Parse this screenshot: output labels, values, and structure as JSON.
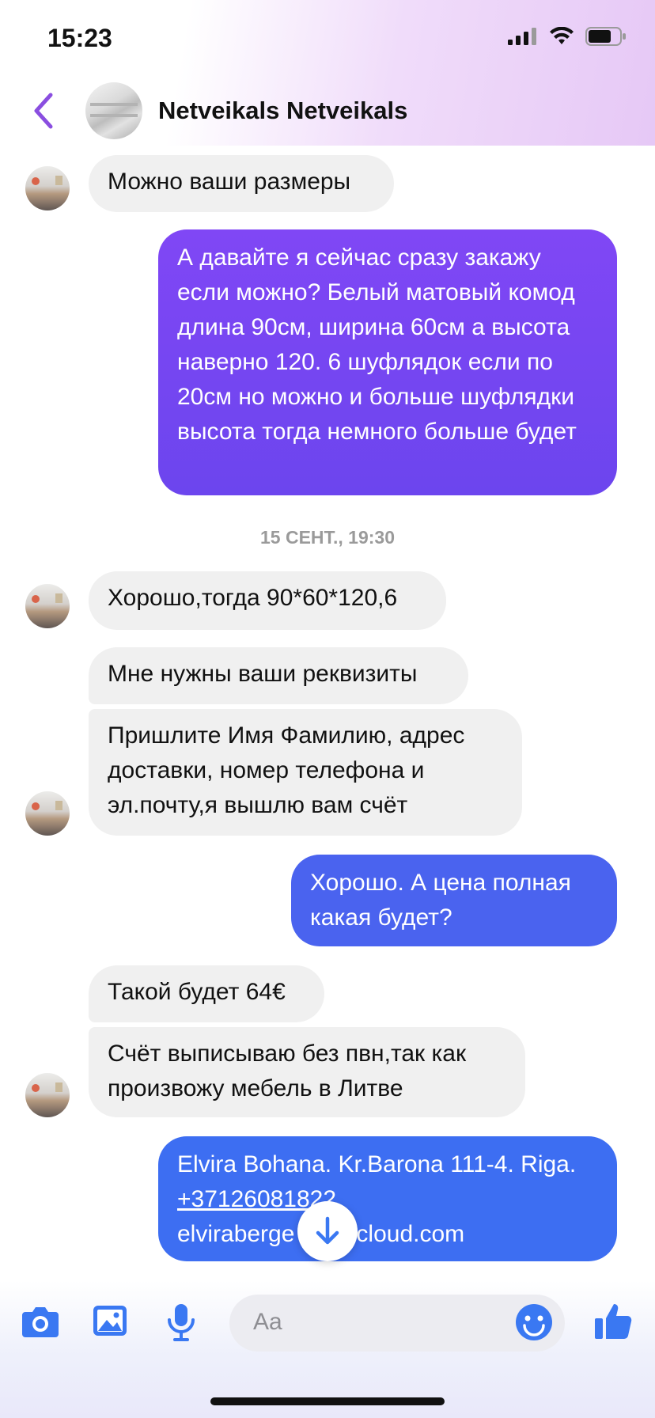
{
  "status_bar": {
    "time": "15:23",
    "icons": [
      "signal-icon",
      "wifi-icon",
      "battery-icon"
    ]
  },
  "header": {
    "back_icon": "chevron-left-icon",
    "contact_name": "Netveikals Netveikals",
    "accent_color": "#8a4ee0"
  },
  "colors": {
    "incoming_bg": "#f0f0f0",
    "outgoing_purple": "#7443f0",
    "outgoing_blue": "#3d6ef2"
  },
  "messages": [
    {
      "side": "in",
      "text": "Можно ваши размеры"
    },
    {
      "side": "out",
      "text": "А давайте я сейчас сразу закажу если можно? Белый матовый комод длина 90см, ширина 60см а высота наверно 120. 6 шуфлядок если по 20см но можно и больше шуфлядки высота тогда немного больше будет"
    },
    {
      "side": "separator",
      "text": "15 СЕНТ., 19:30"
    },
    {
      "side": "in",
      "text": "Хорошо,тогда 90*60*120,6"
    },
    {
      "side": "in",
      "text": "Мне нужны ваши реквизиты"
    },
    {
      "side": "in",
      "text": "Пришлите Имя Фамилию, адрес доставки, номер телефона и эл.почту,я вышлю вам счёт"
    },
    {
      "side": "out",
      "text": "Хорошо. А цена полная какая будет?"
    },
    {
      "side": "in",
      "text": "Такой будет 64€"
    },
    {
      "side": "in",
      "text": "Счёт выписываю без пвн,так как произвожу мебель в Литве"
    },
    {
      "side": "out",
      "line1": "Elvira Bohana. Kr.Barona 111-4. Riga.",
      "phone": "+37126081822",
      "email_visible": "elviraberge",
      "email_visible_end": "cloud.com"
    }
  ],
  "composer": {
    "placeholder": "Aa",
    "icons": [
      "camera-icon",
      "image-icon",
      "microphone-icon",
      "emoji-icon",
      "thumbs-up-icon"
    ]
  },
  "scroll_button_icon": "arrow-down-icon"
}
